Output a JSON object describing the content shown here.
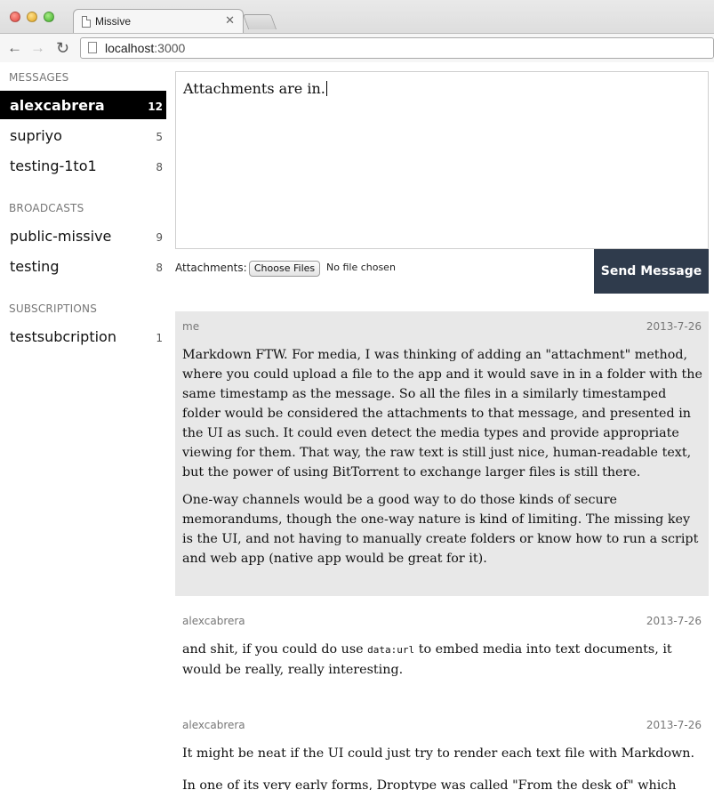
{
  "browser": {
    "tab_title": "Missive",
    "tab_close": "✕",
    "url_host": "localhost",
    "url_port": ":3000",
    "back_glyph": "←",
    "forward_glyph": "→",
    "reload_glyph": "↻"
  },
  "sidebar": {
    "messages_heading": "MESSAGES",
    "messages": [
      {
        "label": "alexcabrera",
        "count": "12",
        "active": true
      },
      {
        "label": "supriyo",
        "count": "5"
      },
      {
        "label": "testing-1to1",
        "count": "8"
      }
    ],
    "broadcasts_heading": "BROADCASTS",
    "broadcasts": [
      {
        "label": "public-missive",
        "count": "9"
      },
      {
        "label": "testing",
        "count": "8"
      }
    ],
    "subscriptions_heading": "SUBSCRIPTIONS",
    "subscriptions": [
      {
        "label": "testsubcription",
        "count": "1"
      }
    ]
  },
  "composer": {
    "text": "Attachments are in.",
    "attachments_label": "Attachments:",
    "choose_files_label": "Choose Files",
    "no_file_text": "No file chosen",
    "send_label": "Send Message"
  },
  "messages": [
    {
      "author": "me",
      "date": "2013-7-26",
      "paragraphs": [
        "Markdown FTW. For media, I was thinking of adding an \"attachment\" method, where you could upload a file to the app and it would save in in a folder with the same timestamp as the message. So all the files in a similarly timestamped folder would be considered the attachments to that message, and presented in the UI as such. It could even detect the media types and provide appropriate viewing for them. That way, the raw text is still just nice, human-readable text, but the power of using BitTorrent to exchange larger files is still there.",
        "One-way channels would be a good way to do those kinds of secure memorandums, though the one-way nature is kind of limiting. The missing key is the UI, and not having to manually create folders or know how to run a script and web app (native app would be great for it)."
      ]
    },
    {
      "author": "alexcabrera",
      "date": "2013-7-26",
      "before_code": "and shit, if you could do use ",
      "code": "data:url",
      "after_code": " to embed media into text documents, it would be really, really interesting."
    },
    {
      "author": "alexcabrera",
      "date": "2013-7-26",
      "paragraphs": [
        "It might be neat if the UI could just try to render each text file with Markdown.",
        "In one of its very early forms, Droptype was called \"From the desk of\" which was"
      ]
    }
  ]
}
